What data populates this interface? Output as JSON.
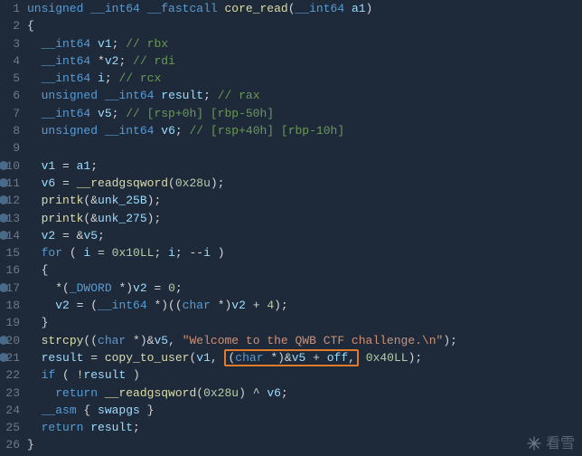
{
  "gutter": {
    "lines": [
      "1",
      "2",
      "3",
      "4",
      "5",
      "6",
      "7",
      "8",
      "9",
      "10",
      "11",
      "12",
      "13",
      "14",
      "15",
      "16",
      "17",
      "18",
      "19",
      "20",
      "21",
      "22",
      "23",
      "24",
      "25",
      "26"
    ],
    "breakpoints": [
      10,
      11,
      12,
      13,
      14,
      17,
      20,
      21
    ]
  },
  "code": {
    "l1": {
      "t1": "unsigned",
      "s1": " ",
      "t2": "__int64",
      "s2": " ",
      "t3": "__fastcall",
      "s3": " ",
      "fn": "core_read",
      "p1": "(",
      "t4": "__int64",
      "s4": " ",
      "a1": "a1",
      "p2": ")"
    },
    "l2": {
      "p": "{"
    },
    "l3": {
      "t1": "__int64",
      "s1": " ",
      "v": "v1",
      "p": ";",
      "c": " // rbx"
    },
    "l4": {
      "t1": "__int64",
      "s1": " *",
      "v": "v2",
      "p": ";",
      "c": " // rdi"
    },
    "l5": {
      "t1": "__int64",
      "s1": " ",
      "v": "i",
      "p": ";",
      "c": " // rcx"
    },
    "l6": {
      "t0": "unsigned",
      "s0": " ",
      "t1": "__int64",
      "s1": " ",
      "v": "result",
      "p": ";",
      "c": " // rax"
    },
    "l7": {
      "t1": "__int64",
      "s1": " ",
      "v": "v5",
      "p": ";",
      "c": " // [rsp+0h] [rbp-50h]"
    },
    "l8": {
      "t0": "unsigned",
      "s0": " ",
      "t1": "__int64",
      "s1": " ",
      "v": "v6",
      "p": ";",
      "c": " // [rsp+40h] [rbp-10h]"
    },
    "l10": {
      "v1": "v1",
      "op": " = ",
      "v2": "a1",
      "p": ";"
    },
    "l11": {
      "v": "v6",
      "op": " = ",
      "fn": "__readgsqword",
      "p1": "(",
      "n": "0x28u",
      "p2": ");"
    },
    "l12": {
      "fn": "printk",
      "p1": "(&",
      "v": "unk_25B",
      "p2": ");"
    },
    "l13": {
      "fn": "printk",
      "p1": "(&",
      "v": "unk_275",
      "p2": ");"
    },
    "l14": {
      "v": "v2",
      "op": " = &",
      "v2": "v5",
      "p": ";"
    },
    "l15": {
      "kw": "for",
      "p1": " ( ",
      "v1": "i",
      "op1": " = ",
      "n": "0x10LL",
      "p2": "; ",
      "v2": "i",
      "p3": "; --",
      "v3": "i",
      "p4": " )"
    },
    "l16": {
      "p": "{"
    },
    "l17": {
      "p1": "*(",
      "t": "_DWORD",
      "p2": " *)",
      "v": "v2",
      "op": " = ",
      "n": "0",
      "p3": ";"
    },
    "l18": {
      "v1": "v2",
      "op1": " = (",
      "t1": "__int64",
      "p1": " *)((",
      "t2": "char",
      "p2": " *)",
      "v2": "v2",
      "op2": " + ",
      "n": "4",
      "p3": ");"
    },
    "l19": {
      "p": "}"
    },
    "l20": {
      "fn": "strcpy",
      "p1": "((",
      "t": "char",
      "p2": " *)&",
      "v": "v5",
      "p3": ", ",
      "s": "\"Welcome to the QWB CTF challenge.\\n\"",
      "p4": ");"
    },
    "l21": {
      "v": "result",
      "op": " = ",
      "fn": "copy_to_user",
      "p1": "(",
      "a1": "v1",
      "p2": ", ",
      "hl_p1": "(",
      "hl_t": "char",
      "hl_p2": " *)&",
      "hl_v": "v5",
      "hl_op": " + ",
      "hl_o": "off",
      "hl_p3": ",",
      "p3": " ",
      "n": "0x40LL",
      "p4": ");"
    },
    "l22": {
      "kw": "if",
      "p1": " ( !",
      "v": "result",
      "p2": " )"
    },
    "l23": {
      "kw": "return",
      "s1": " ",
      "fn": "__readgsqword",
      "p1": "(",
      "n": "0x28u",
      "p2": ") ^ ",
      "v": "v6",
      "p3": ";"
    },
    "l24": {
      "kw": "__asm",
      "p1": " { ",
      "v": "swapgs",
      "p2": " }"
    },
    "l25": {
      "kw": "return",
      "s1": " ",
      "v": "result",
      "p": ";"
    },
    "l26": {
      "p": "}"
    }
  },
  "watermark": {
    "text": "看雪"
  }
}
